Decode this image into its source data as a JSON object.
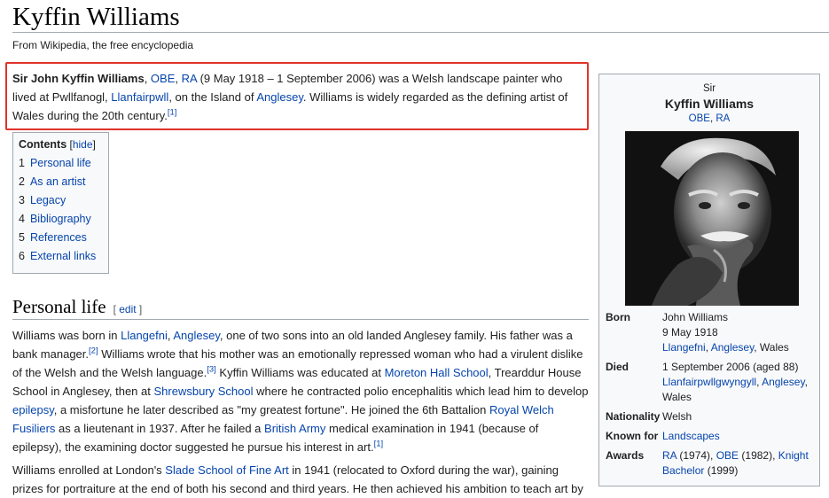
{
  "page": {
    "title": "Kyffin Williams",
    "tagline": "From Wikipedia, the free encyclopedia"
  },
  "lead": {
    "bold_name": "Sir John Kyffin Williams",
    "sep1": ", ",
    "obe": "OBE",
    "sep2": ", ",
    "ra": "RA",
    "t1": " (9 May 1918 – 1 September 2006) was a Welsh landscape painter who lived at Pwllfanogl, ",
    "llanfairpwll": "Llanfairpwll",
    "t2": ", on the Island of ",
    "anglesey": "Anglesey",
    "t3": ". Williams is widely regarded as the defining artist of Wales during the 20th century.",
    "ref1": "[1]"
  },
  "toc": {
    "title": "Contents",
    "hide_open": " [",
    "hide": "hide",
    "hide_close": "]",
    "items": [
      {
        "num": "1",
        "label": "Personal life"
      },
      {
        "num": "2",
        "label": "As an artist"
      },
      {
        "num": "3",
        "label": "Legacy"
      },
      {
        "num": "4",
        "label": "Bibliography"
      },
      {
        "num": "5",
        "label": "References"
      },
      {
        "num": "6",
        "label": "External links"
      }
    ]
  },
  "section1": {
    "heading": "Personal life",
    "edit_open": "[ ",
    "edit": "edit",
    "edit_close": " ]"
  },
  "p1": {
    "t1": "Williams was born in ",
    "l1": "Llangefni",
    "t2": ", ",
    "l2": "Anglesey",
    "t3": ", one of two sons into an old landed Anglesey family. His father was a bank manager.",
    "r2": "[2]",
    "t4": " Williams wrote that his mother was an emotionally repressed woman who had a virulent dislike of the Welsh and the Welsh language.",
    "r3": "[3]",
    "t5": " Kyffin Williams was educated at ",
    "l3": "Moreton Hall School",
    "t6": ", Trearddur House School in Anglesey, then at ",
    "l4": "Shrewsbury School",
    "t7": " where he contracted polio encephalitis which lead him to develop ",
    "l5": "epilepsy",
    "t8": ", a misfortune he later described as \"my greatest fortune\". He joined the 6th Battalion ",
    "l6": "Royal Welch Fusiliers",
    "t9": " as a lieutenant in 1937. After he failed a ",
    "l7": "British Army",
    "t10": " medical examination in 1941 (because of epilepsy), the examining doctor suggested he pursue his interest in art.",
    "r1": "[1]"
  },
  "p2": {
    "t1": "Williams enrolled at London's ",
    "l1": "Slade School of Fine Art",
    "t2": " in 1941 (relocated to Oxford during the war), gaining prizes for portraiture at the end of both his second and third years. He then achieved his ambition to teach art by"
  },
  "infobox": {
    "pre": "Sir",
    "name": "Kyffin Williams",
    "post_obe": "OBE",
    "post_sep": ", ",
    "post_ra": "RA",
    "born_label": "Born",
    "born_name": "John Williams",
    "born_date": "9 May 1918",
    "born_place_1": "Llangefni",
    "born_sep": ", ",
    "born_place_2": "Anglesey",
    "born_place_3": ", Wales",
    "died_label": "Died",
    "died_date": "1 September 2006 (aged 88)",
    "died_place_1": "Llanfairpwllgwyngyll",
    "died_sep": ", ",
    "died_place_2": "Anglesey",
    "died_place_3": ",",
    "died_place_4": "Wales",
    "nat_label": "Nationality",
    "nat_val": "Welsh",
    "known_label": "Known for",
    "known_val": "Landscapes",
    "awards_label": "Awards",
    "aw1": "RA",
    "aw1_t": " (1974), ",
    "aw2": "OBE",
    "aw2_t": " (1982), ",
    "aw3": "Knight Bachelor",
    "aw3_t": " (1999)"
  },
  "colors": {
    "link": "#0645ad",
    "highlight_border": "#e0332b",
    "rule": "#a2a9b1",
    "infobox_bg": "#f8f9fa"
  }
}
